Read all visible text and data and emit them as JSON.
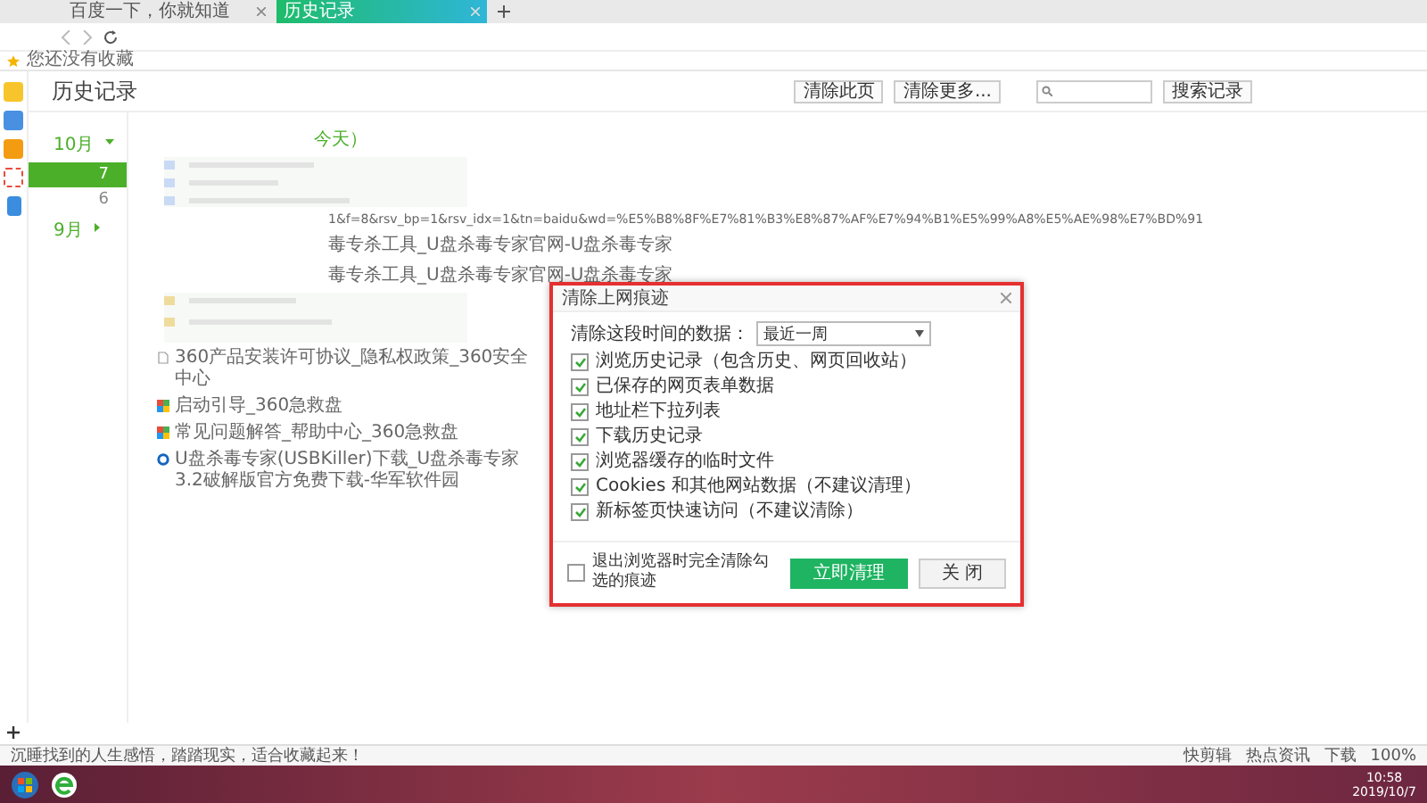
{
  "tabs": [
    {
      "label": "百度一下，你就知道",
      "selected": false
    },
    {
      "label": "历史记录",
      "selected": true
    }
  ],
  "bookmarks_bar": {
    "label": "您还没有收藏"
  },
  "page": {
    "title": "历史记录",
    "buttons": [
      "清除此页",
      "清除更多..."
    ],
    "search_button": "搜索记录"
  },
  "months": [
    {
      "label": "10月",
      "expanded": true,
      "days": [
        {
          "label": "7",
          "selected": true
        },
        {
          "label": "6",
          "selected": false
        }
      ]
    },
    {
      "label": "9月",
      "expanded": false
    }
  ],
  "history": {
    "date_heading": "今天）",
    "url_line": "1&f=8&rsv_bp=1&rsv_idx=1&tn=baidu&wd=%E5%B8%8F%E7%81%B3%E8%87%AF%E7%94%B1%E5%99%A8%E5%AE%98%E7%BD%91",
    "partial_lines": [
      "毒专杀工具_U盘杀毒专家官网-U盘杀毒专家",
      "毒专杀工具_U盘杀毒专家官网-U盘杀毒专家"
    ],
    "entries": [
      {
        "kind": "page",
        "title": "360产品安装许可协议_隐私权政策_360安全中心"
      },
      {
        "kind": "app",
        "title": "启动引导_360急救盘"
      },
      {
        "kind": "app",
        "title": "常见问题解答_帮助中心_360急救盘"
      },
      {
        "kind": "site",
        "title": "U盘杀毒专家(USBKiller)下载_U盘杀毒专家3.2破解版官方免费下载-华军软件园"
      }
    ]
  },
  "dialog": {
    "title": "清除上网痕迹",
    "range_label": "清除这段时间的数据：",
    "range_value": "最近一周",
    "options": [
      {
        "label": "浏览历史记录（包含历史、网页回收站）",
        "checked": true
      },
      {
        "label": "已保存的网页表单数据",
        "checked": true
      },
      {
        "label": "地址栏下拉列表",
        "checked": true
      },
      {
        "label": "下载历史记录",
        "checked": true
      },
      {
        "label": "浏览器缓存的临时文件",
        "checked": true
      },
      {
        "label": "Cookies 和其他网站数据（不建议清理）",
        "checked": true
      },
      {
        "label": "新标签页快速访问（不建议清除）",
        "checked": true
      }
    ],
    "exit_option": {
      "label": "退出浏览器时完全清除勾选的痕迹",
      "checked": false
    },
    "buttons": [
      {
        "kind": "primary",
        "label": "立即清理"
      },
      {
        "kind": "secondary",
        "label": "关 闭"
      }
    ]
  },
  "status_bar": {
    "text": "沉睡找到的人生感悟，踏踏现实，适合收藏起来！",
    "items": [
      "快剪辑",
      "热点资讯",
      "下载",
      "100%"
    ]
  },
  "taskbar": {
    "time": "10:58",
    "date": "2019/10/7"
  }
}
